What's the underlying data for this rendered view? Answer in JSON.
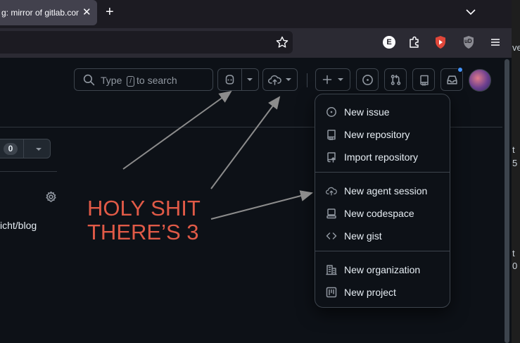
{
  "browser": {
    "tab_title": "g: mirror of gitlab.com/",
    "tab_close": "✕",
    "new_tab": "+",
    "extension_badge": "E",
    "ublock_badge": "uD"
  },
  "header": {
    "search_prefix": "Type",
    "search_key": "/",
    "search_suffix": "to search"
  },
  "left_panel": {
    "counter": "0",
    "repo_fragment": "icht/blog"
  },
  "menu": {
    "groups": [
      [
        {
          "label": "New issue",
          "icon": "issue-opened-icon"
        },
        {
          "label": "New repository",
          "icon": "repo-icon"
        },
        {
          "label": "Import repository",
          "icon": "repo-push-icon"
        }
      ],
      [
        {
          "label": "New agent session",
          "icon": "cloud-agent-icon"
        },
        {
          "label": "New codespace",
          "icon": "codespaces-icon"
        },
        {
          "label": "New gist",
          "icon": "code-icon"
        }
      ],
      [
        {
          "label": "New organization",
          "icon": "organization-icon"
        },
        {
          "label": "New project",
          "icon": "project-icon"
        }
      ]
    ]
  },
  "annotation": {
    "line1": "HOLY SHIT",
    "line2": "THERE’S 3",
    "color": "#e05a47"
  },
  "right_pane": {
    "fragments": [
      "ve",
      "t",
      "5",
      "t",
      "0"
    ]
  }
}
